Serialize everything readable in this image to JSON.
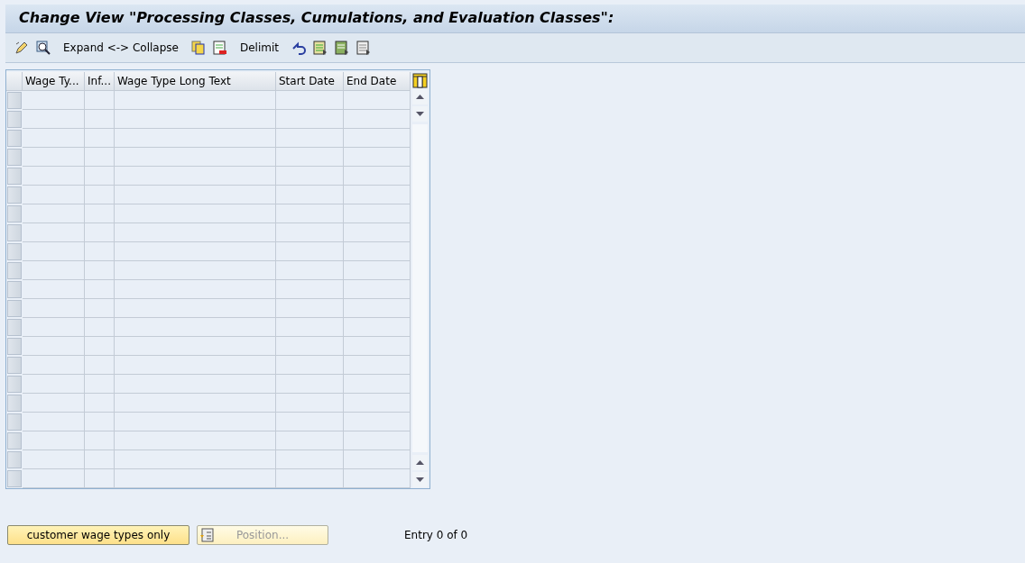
{
  "title": "Change View \"Processing Classes, Cumulations, and Evaluation Classes\":",
  "toolbar": {
    "expand_collapse": "Expand <-> Collapse",
    "delimit": "Delimit"
  },
  "table": {
    "columns": [
      "Wage Ty...",
      "Inf...",
      "Wage Type Long Text",
      "Start Date",
      "End Date"
    ]
  },
  "buttons": [
    {
      "label": "customer wage types only",
      "disabled": false,
      "kind": "plain"
    },
    {
      "label": "Position...",
      "disabled": true,
      "kind": "position"
    }
  ],
  "status": "Entry 0 of 0"
}
